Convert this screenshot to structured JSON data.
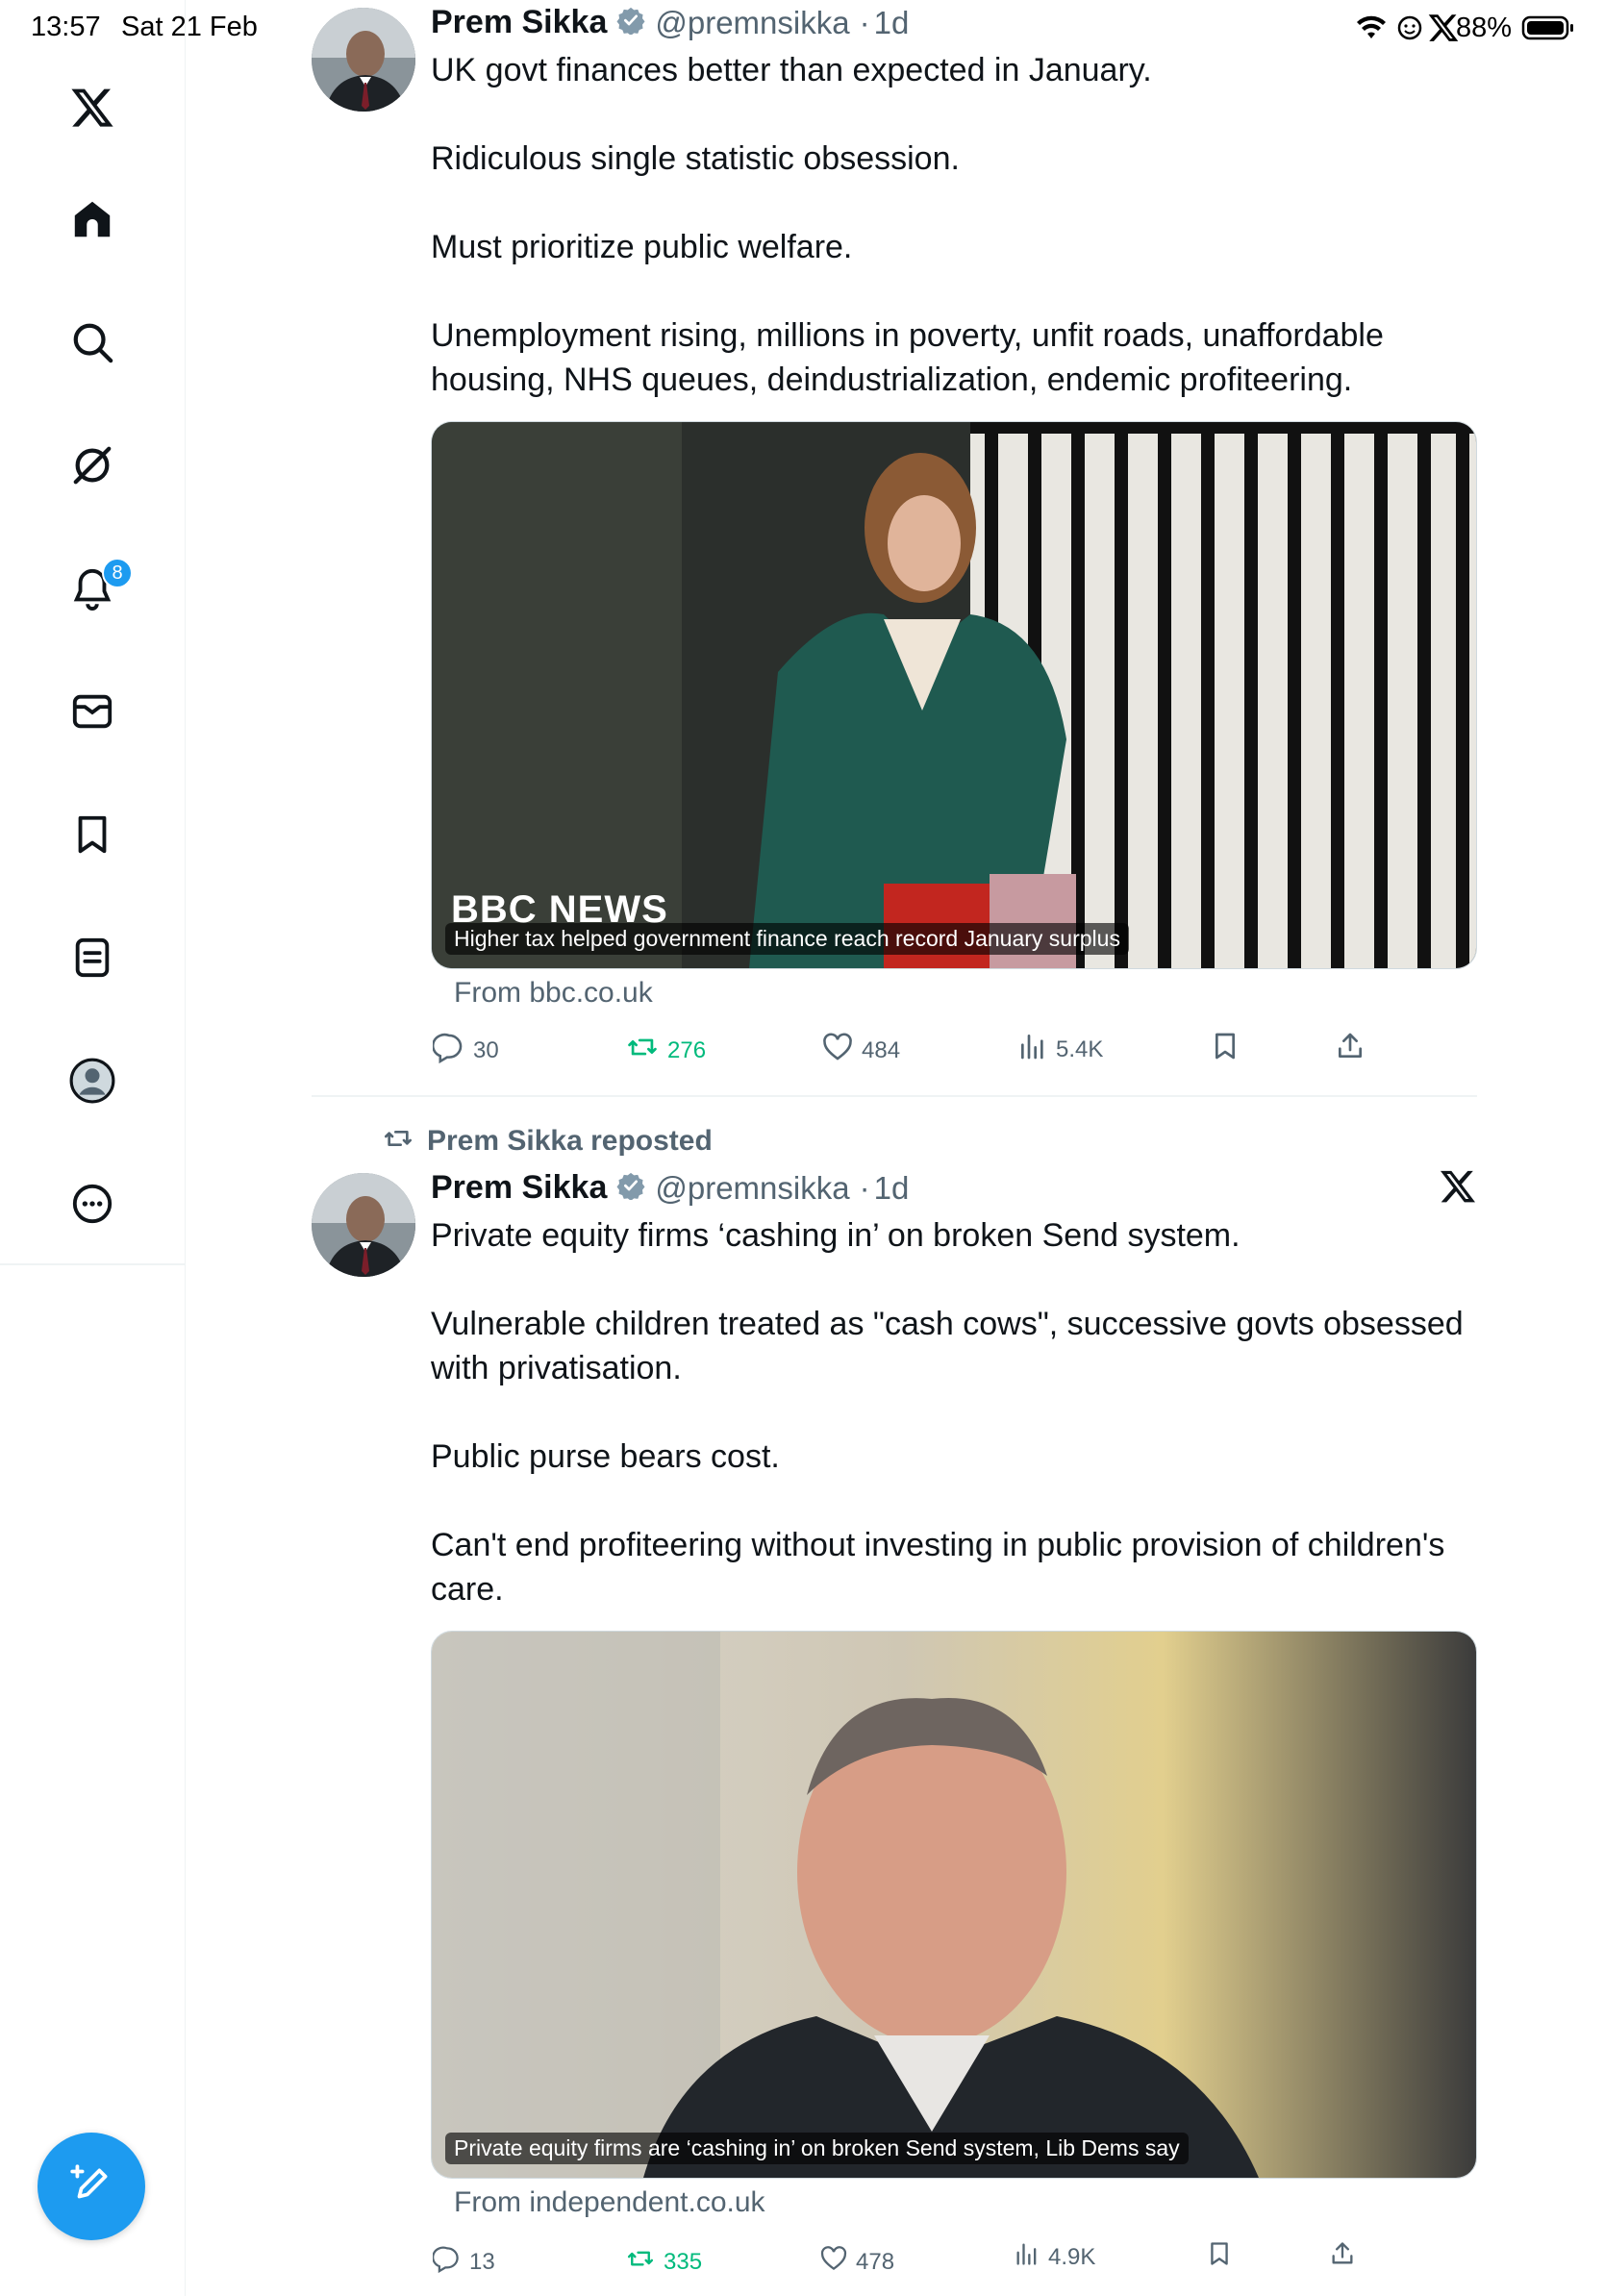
{
  "status_bar": {
    "time": "13:57",
    "date": "Sat 21 Feb",
    "battery": "88%",
    "icons": [
      "wifi-icon",
      "emoji-icon",
      "x-logo-icon",
      "battery-icon"
    ]
  },
  "sidebar": {
    "items": [
      {
        "name": "x-logo-icon"
      },
      {
        "name": "home-icon"
      },
      {
        "name": "search-icon"
      },
      {
        "name": "grok-icon"
      },
      {
        "name": "notifications-icon",
        "badge": "8"
      },
      {
        "name": "messages-icon"
      },
      {
        "name": "bookmarks-icon"
      },
      {
        "name": "lists-icon"
      },
      {
        "name": "profile-icon"
      },
      {
        "name": "more-icon"
      }
    ],
    "compose_icon": "compose-icon"
  },
  "tweets": [
    {
      "author": "Prem Sikka",
      "handle": "@premnsikka",
      "age": "1d",
      "text": "UK govt finances better than expected in January.\n\nRidiculous single statistic obsession.\n\nMust prioritize public welfare.\n\nUnemployment rising, millions in poverty, unfit roads, unaffordable housing, NHS queues, deindustrialization, endemic profiteering.",
      "media_logo": "BBC NEWS",
      "media_caption": "Higher tax helped government finance reach record January surplus",
      "source": "From bbc.co.uk",
      "replies": "30",
      "reposts": "276",
      "likes": "484",
      "views": "5.4K"
    },
    {
      "repost_label": "Prem Sikka reposted",
      "author": "Prem Sikka",
      "handle": "@premnsikka",
      "age": "1d",
      "text": "Private equity firms ‘cashing in’ on broken Send system.\n\nVulnerable children treated as \"cash cows\", successive govts obsessed with privatisation.\n\nPublic purse bears cost.\n\nCan't end profiteering without investing in public provision of children's care.",
      "media_caption": "Private equity firms are ‘cashing in’ on broken Send system, Lib Dems say",
      "source": "From independent.co.uk",
      "replies": "13",
      "reposts": "335",
      "likes": "478",
      "views": "4.9K"
    }
  ],
  "colors": {
    "accent": "#1d9bf0",
    "repost_green": "#00ba7c",
    "muted": "#536471",
    "text": "#0f1419"
  }
}
